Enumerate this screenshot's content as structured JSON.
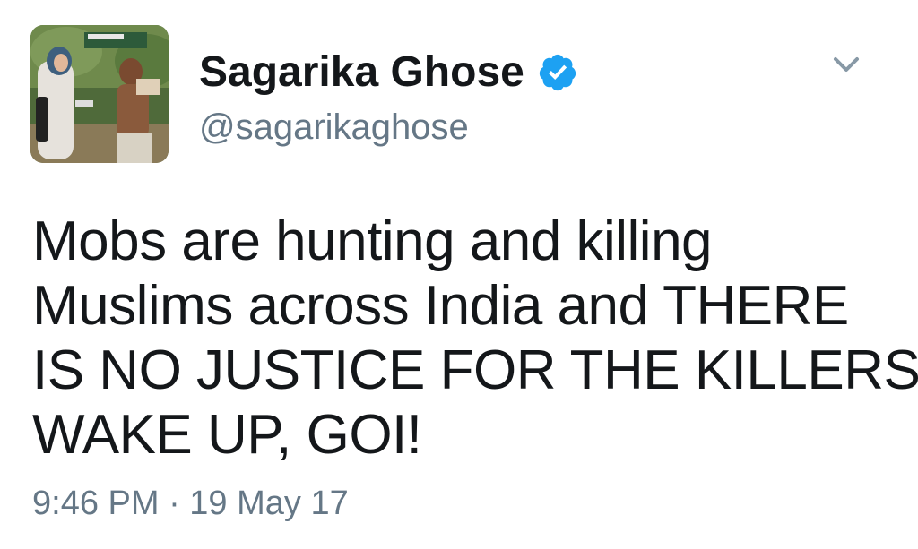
{
  "author": {
    "display_name": "Sagarika Ghose",
    "handle": "@sagarikaghose",
    "verified": true,
    "verified_icon": "verified-badge-icon",
    "avatar_icon": "profile-photo"
  },
  "tweet": {
    "lines": [
      "Mobs are hunting and killing",
      "Muslims across India and THERE",
      "IS NO JUSTICE FOR THE KILLERS!",
      "WAKE UP, GOI!"
    ],
    "timestamp": "9:46 PM · 19 May 17"
  },
  "menu": {
    "icon": "chevron-down-icon"
  },
  "colors": {
    "text_primary": "#14171a",
    "text_secondary": "#657786",
    "verified_blue": "#1da1f2",
    "caret_gray": "#8899a6",
    "background": "#ffffff"
  }
}
